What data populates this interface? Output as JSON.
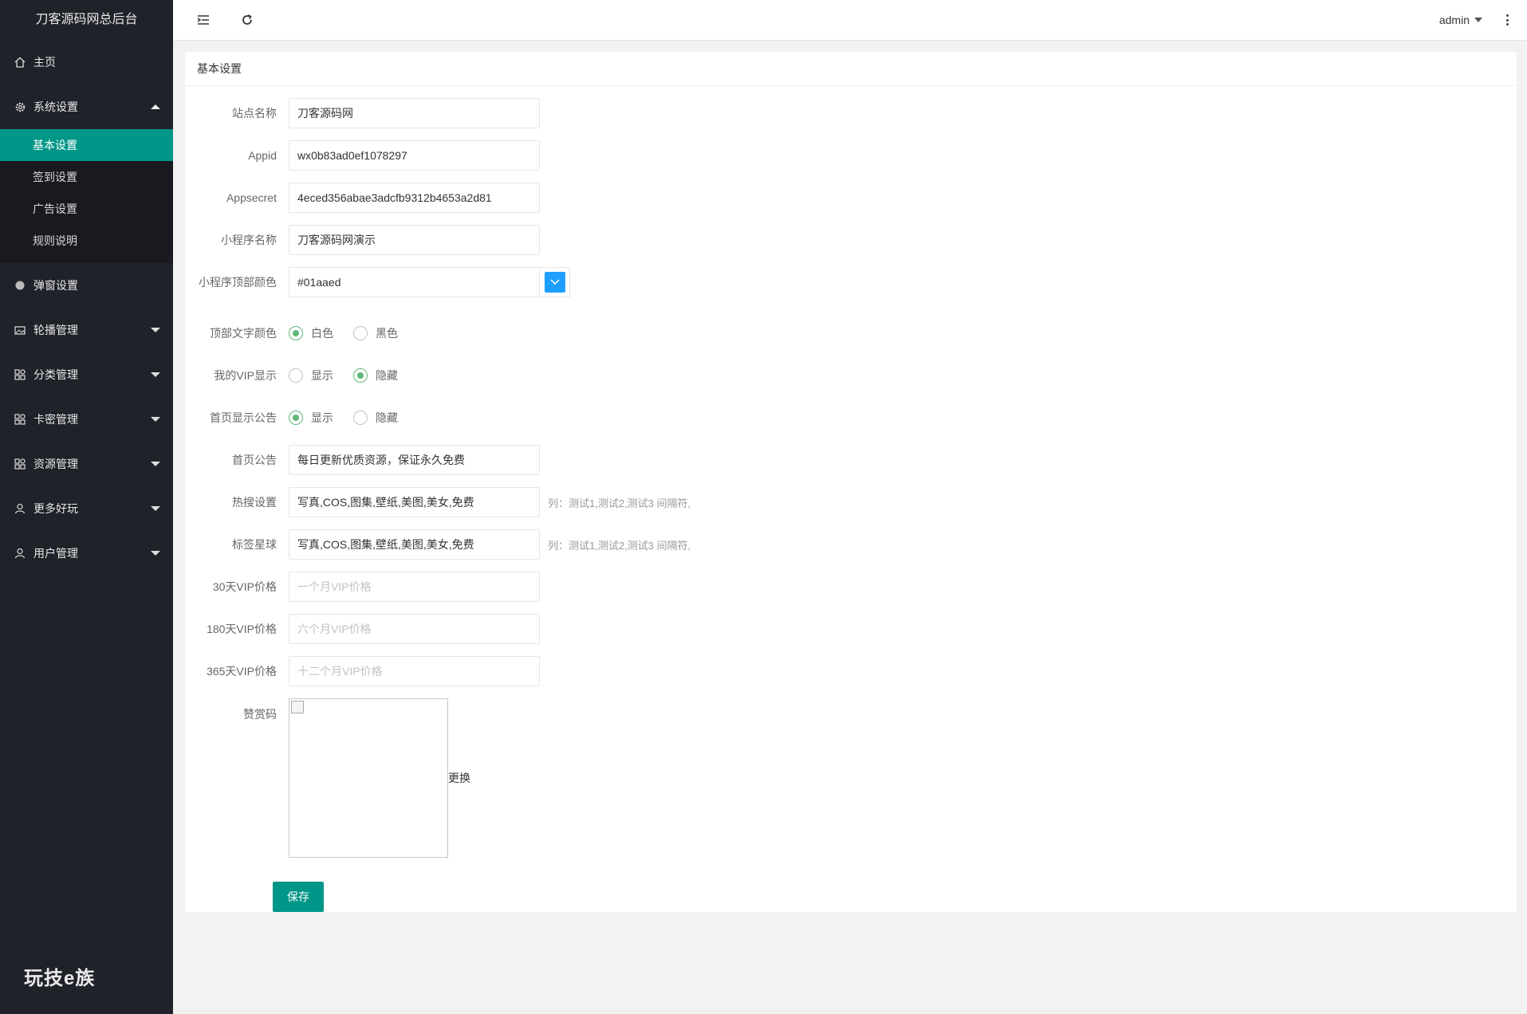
{
  "sidebar": {
    "logo": "刀客源码网总后台",
    "home": "主页",
    "system_settings": "系统设置",
    "submenu": [
      "基本设置",
      "签到设置",
      "广告设置",
      "规则说明"
    ],
    "items": [
      "弹窗设置",
      "轮播管理",
      "分类管理",
      "卡密管理",
      "资源管理",
      "更多好玩",
      "用户管理"
    ],
    "brand": "玩技e族"
  },
  "header": {
    "user": "admin"
  },
  "card": {
    "title": "基本设置"
  },
  "form": {
    "site_name": {
      "label": "站点名称",
      "value": "刀客源码网"
    },
    "appid": {
      "label": "Appid",
      "value": "wx0b83ad0ef1078297"
    },
    "appsecret": {
      "label": "Appsecret",
      "value": "4eced356abae3adcfb9312b4653a2d81"
    },
    "mini_name": {
      "label": "小程序名称",
      "value": "刀客源码网演示"
    },
    "top_color": {
      "label": "小程序顶部颜色",
      "value": "#01aaed",
      "swatch": "#1e9fff"
    },
    "text_color": {
      "label": "顶部文字颜色",
      "opt1": "白色",
      "opt2": "黑色",
      "selected": "白色"
    },
    "vip_show": {
      "label": "我的VIP显示",
      "opt1": "显示",
      "opt2": "隐藏",
      "selected": "隐藏"
    },
    "notice_show": {
      "label": "首页显示公告",
      "opt1": "显示",
      "opt2": "隐藏",
      "selected": "显示"
    },
    "notice": {
      "label": "首页公告",
      "value": "每日更新优质资源，保证永久免费"
    },
    "hot_search": {
      "label": "热搜设置",
      "value": "写真,COS,图集,壁纸,美图,美女,免费",
      "hint": "列：测试1,测试2,测试3 间隔符,"
    },
    "tags": {
      "label": "标签星球",
      "value": "写真,COS,图集,壁纸,美图,美女,免费",
      "hint": "列：测试1,测试2,测试3 间隔符,"
    },
    "vip30": {
      "label": "30天VIP价格",
      "placeholder": "一个月VIP价格"
    },
    "vip180": {
      "label": "180天VIP价格",
      "placeholder": "六个月VIP价格"
    },
    "vip365": {
      "label": "365天VIP价格",
      "placeholder": "十二个月VIP价格"
    },
    "reward": {
      "label": "赞赏码",
      "replace": "更换"
    },
    "save": "保存"
  },
  "colors": {
    "sidebar_bg": "#20222a",
    "active": "#009688",
    "radio_on": "#5fb878"
  }
}
